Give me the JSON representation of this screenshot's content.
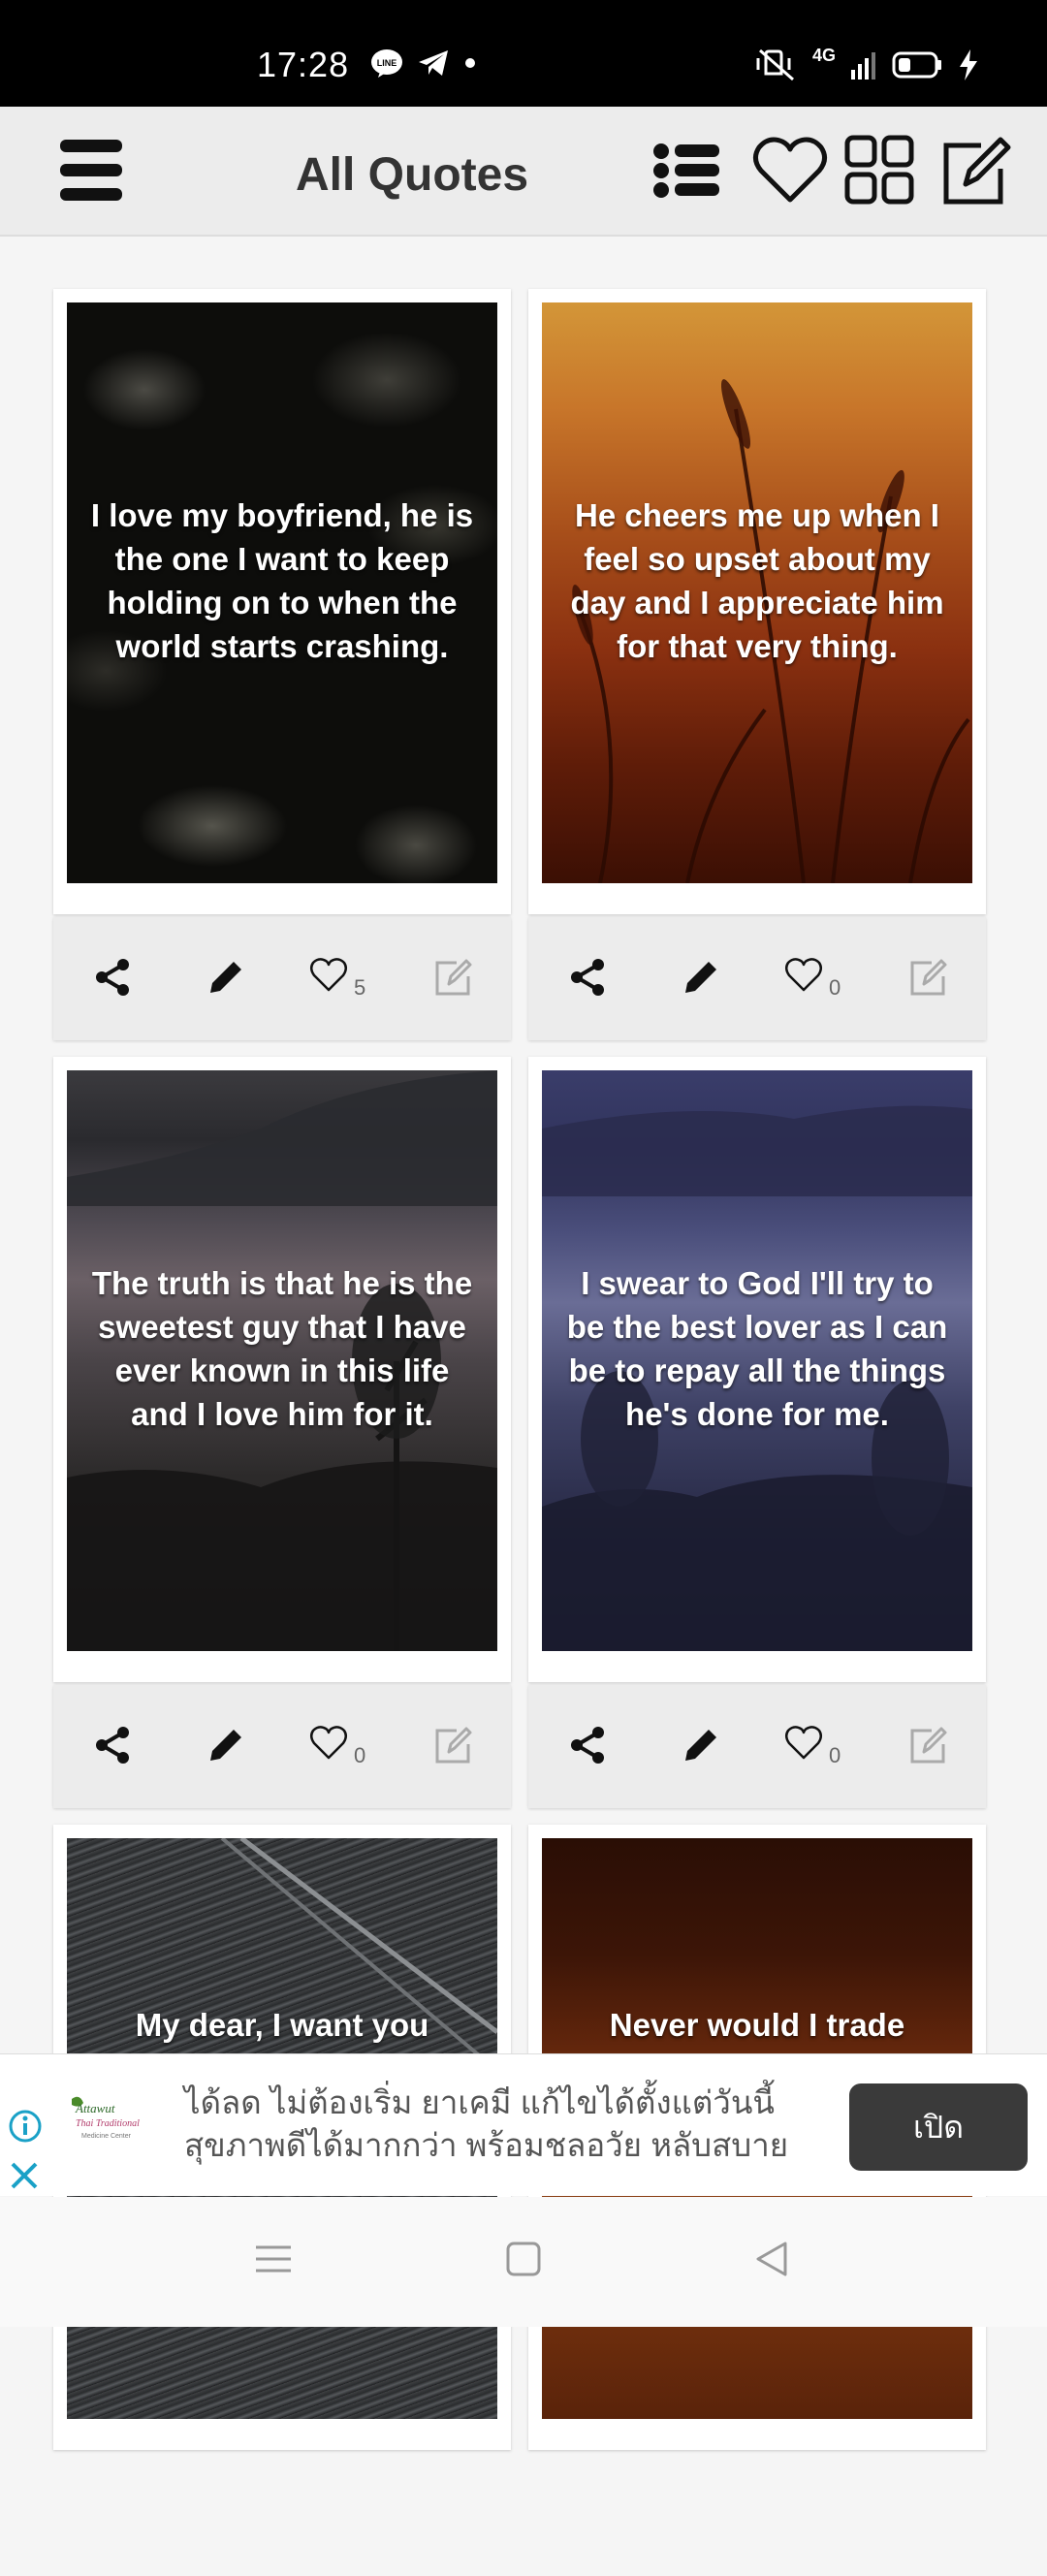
{
  "status_bar": {
    "time": "17:28",
    "network": "4G",
    "line_label": "LINE"
  },
  "app_bar": {
    "title": "All Quotes",
    "icons": [
      "menu-icon",
      "list-icon",
      "heart-icon",
      "grid-icon",
      "edit-icon"
    ]
  },
  "quotes": [
    {
      "text": "I love my boyfriend, he is the one I want to keep holding on to when the world starts crashing.",
      "likes": "5"
    },
    {
      "text": "He cheers me up when I feel so upset about my day and I appreciate him for that very thing.",
      "likes": "0"
    },
    {
      "text": "The truth is that he is the sweetest guy that I have ever known in this life and I love him for it.",
      "likes": "0"
    },
    {
      "text": "I swear to God I'll try to be the best lover as I can be to repay all the things he's done for me.",
      "likes": "0"
    },
    {
      "text": "My dear, I want you"
    },
    {
      "text": "Never would I trade"
    }
  ],
  "ad": {
    "logo_line1": "Attawut",
    "logo_line2": "Thai Traditional",
    "logo_line3": "Medicine Center",
    "line1": "ได้ลด ไม่ต้องเริ่ม ยาเคมี แก้ไขได้ตั้งแต่วันนี้",
    "line2": "สุขภาพดีได้มากกว่า พร้อมชลอวัย หลับสบาย",
    "cta": "เปิด"
  },
  "colors": {
    "status_bg": "#000000",
    "appbar_bg": "#ececec",
    "ad_button": "#3a3a3a"
  }
}
